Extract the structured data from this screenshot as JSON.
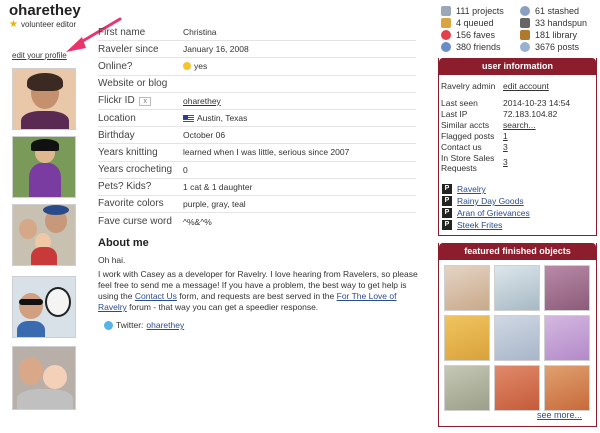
{
  "profile": {
    "username": "oharethey",
    "role": "volunteer editor",
    "edit_link": "edit your profile"
  },
  "info_rows": [
    {
      "label": "First name",
      "value": "Christina"
    },
    {
      "label": "Raveler since",
      "value": "January 16, 2008"
    },
    {
      "label": "Online?",
      "value": "yes"
    },
    {
      "label": "Website or blog",
      "value": ""
    },
    {
      "label": "Flickr ID",
      "value": "oharethey",
      "badge": "x"
    },
    {
      "label": "Location",
      "value": "Austin, Texas"
    },
    {
      "label": "Birthday",
      "value": "October 06"
    },
    {
      "label": "Years knitting",
      "value": "learned when I was little, serious since 2007"
    },
    {
      "label": "Years crocheting",
      "value": "0"
    },
    {
      "label": "Pets? Kids?",
      "value": "1 cat & 1 daughter"
    },
    {
      "label": "Favorite colors",
      "value": "purple, gray, teal"
    },
    {
      "label": "Fave curse word",
      "value": "^%&^%"
    }
  ],
  "about": {
    "heading": "About me",
    "p1": "Oh hai.",
    "p2_a": "I work with Casey as a developer for Ravelry. I love hearing from Ravelers, so please feel free to send me a message! If you have a problem, the best way to get help is using the ",
    "contact_link": "Contact Us",
    "p2_b": " form, and requests are best served in the ",
    "forum_link": "For The Love of Ravelry",
    "p2_c": " forum - that way you can get a speedier response.",
    "twitter_label": "Twitter:",
    "twitter_handle": "oharethey"
  },
  "stats": [
    {
      "label": "111 projects",
      "icon": "projects-icon",
      "color": "#9aa8b8"
    },
    {
      "label": "61 stashed",
      "icon": "stash-icon",
      "color": "#8aa0c0"
    },
    {
      "label": "4 queued",
      "icon": "queue-icon",
      "color": "#d9a441"
    },
    {
      "label": "33 handspun",
      "icon": "handspun-icon",
      "color": "#666666"
    },
    {
      "label": "156 faves",
      "icon": "heart-icon",
      "color": "#e0414b"
    },
    {
      "label": "181 library",
      "icon": "library-icon",
      "color": "#b07a2c"
    },
    {
      "label": "380 friends",
      "icon": "friends-icon",
      "color": "#6a8cc8"
    },
    {
      "label": "3676 posts",
      "icon": "posts-icon",
      "color": "#9ab0d0"
    }
  ],
  "user_info": {
    "heading": "user information",
    "admin_label": "Ravelry admin",
    "admin_link": "edit account",
    "last_seen_label": "Last seen",
    "last_seen": "2014-10-23 14:54",
    "last_ip_label": "Last IP",
    "last_ip": "72.183.104.82",
    "similar_label": "Similar accts",
    "similar_link": "search...",
    "flagged_label": "Flagged posts",
    "flagged": "1",
    "contact_label": "Contact us",
    "contact": "3",
    "store_label_1": "In Store Sales",
    "store_label_2": "Requests",
    "store": "3",
    "groups": [
      "Ravelry",
      "Rainy Day Goods",
      "Aran of Grievances",
      "Steek Frites"
    ]
  },
  "featured": {
    "heading": "featured finished objects",
    "see_more": "see more...",
    "tile_colors": [
      "#c9a98a",
      "#a7b9c4",
      "#8c5b7a",
      "#d9a23a",
      "#a8b6c9",
      "#b38ac9",
      "#9ca08a",
      "#c55b3a",
      "#c86a3a"
    ]
  },
  "colors": {
    "accent": "#8c1d2c",
    "link": "#2a4d8f",
    "arrow": "#e8356e"
  }
}
